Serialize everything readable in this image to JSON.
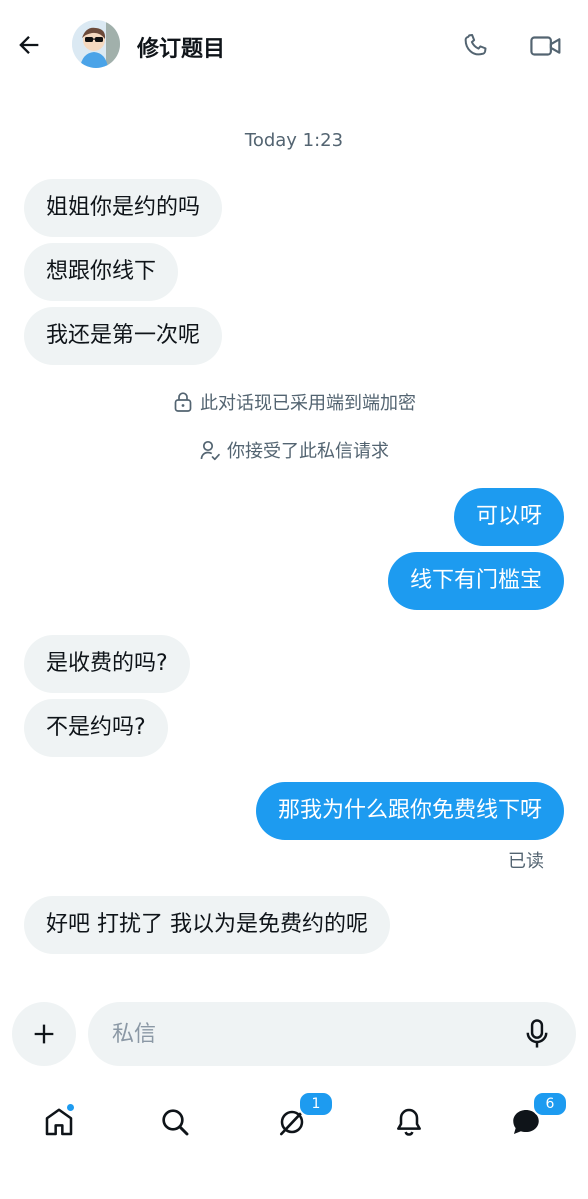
{
  "header": {
    "title": "修订题目"
  },
  "icons": {
    "back": "arrow-left-icon",
    "call": "phone-icon",
    "video": "video-camera-icon",
    "lock": "lock-icon",
    "person": "person-check-icon",
    "add": "plus-icon",
    "mic": "microphone-icon",
    "home": "home-icon",
    "search": "search-icon",
    "grok": "grok-icon",
    "notifications": "bell-icon",
    "messages": "messages-icon"
  },
  "conversation": {
    "timestamp": "Today 1:23",
    "encryption_note": "此对话现已采用端到端加密",
    "request_note": "你接受了此私信请求",
    "messages": [
      {
        "dir": "in",
        "text": "姐姐你是约的吗"
      },
      {
        "dir": "in",
        "text": "想跟你线下"
      },
      {
        "dir": "in",
        "text": "我还是第一次呢"
      },
      {
        "dir": "out",
        "text": "可以呀"
      },
      {
        "dir": "out",
        "text": "线下有门槛宝"
      },
      {
        "dir": "in",
        "text": "是收费的吗?"
      },
      {
        "dir": "in",
        "text": "不是约吗?"
      },
      {
        "dir": "out",
        "text": "那我为什么跟你免费线下呀"
      },
      {
        "dir": "in",
        "text": "好吧 打扰了  我以为是免费约的呢"
      }
    ],
    "read_status": "已读"
  },
  "composer": {
    "placeholder": "私信",
    "value": ""
  },
  "nav": {
    "grok_badge": "1",
    "messages_badge": "6"
  },
  "colors": {
    "accent": "#1d9bf0",
    "incoming_bubble": "#eff3f4",
    "muted_text": "#536471"
  }
}
